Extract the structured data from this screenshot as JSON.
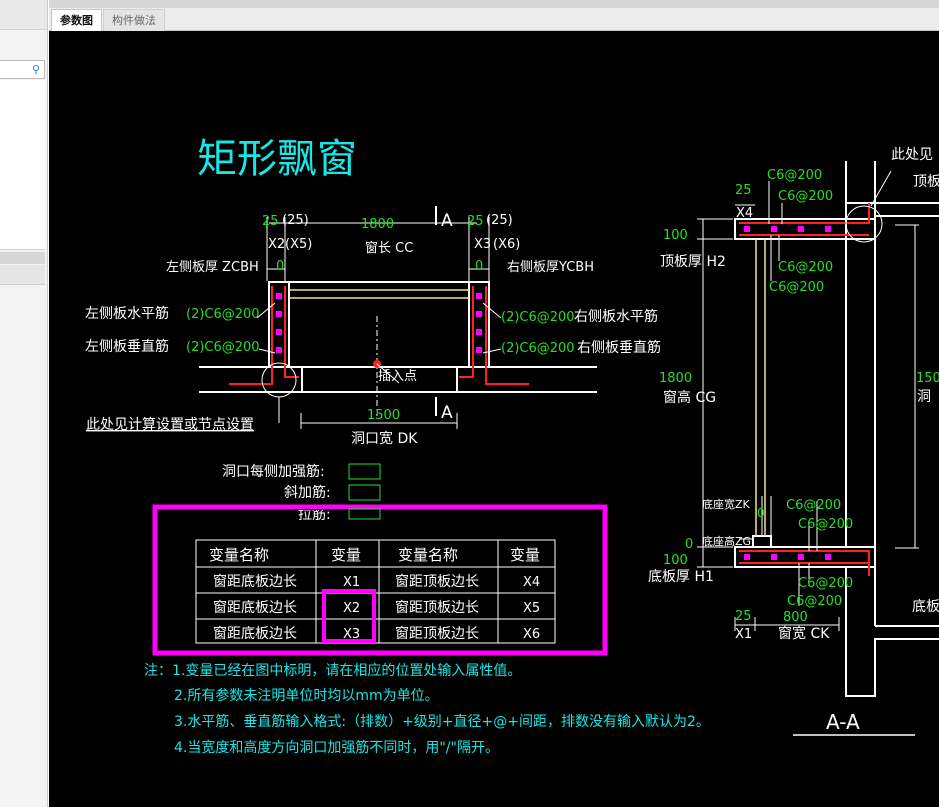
{
  "tabs": [
    {
      "label": "参数图"
    },
    {
      "label": "构件做法"
    }
  ],
  "drawing": {
    "title": "矩形飘窗",
    "plan": {
      "x2_val": "25",
      "x2_paren": "(25)",
      "x2_label": "X2",
      "x5_label": "(X5)",
      "cc_val": "1800",
      "cc_label": "窗长 CC",
      "x3_val": "25",
      "x3_paren": "(25)",
      "x3_label": "X3",
      "x6_label": "(X6)",
      "section_mark": "A",
      "left_thk_label": "左侧板厚 ZCBH",
      "left_thk_val": "0",
      "right_thk_label": "右侧板厚YCBH",
      "right_thk_val": "0",
      "left_h_label": "左侧板水平筋",
      "left_h_val": "(2)C6@200",
      "left_v_label": "左侧板垂直筋",
      "left_v_val": "(2)C6@200",
      "right_h_val": "(2)C6@200",
      "right_h_label": "右侧板水平筋",
      "right_v_val": "(2)C6@200",
      "right_v_label": "右侧板垂直筋",
      "insert_point": "插入点",
      "dk_val": "1500",
      "dk_label": "洞口宽 DK",
      "node_note": "此处见计算设置或节点设置"
    },
    "params": {
      "per_side_label": "洞口每侧加强筋:",
      "diag_label": "斜加筋:",
      "tie_label": "拉筋:"
    },
    "table": {
      "headers": [
        "变量名称",
        "变量",
        "变量名称",
        "变量"
      ],
      "rows": [
        [
          "窗距底板边长",
          "X1",
          "窗距顶板边长",
          "X4"
        ],
        [
          "窗距底板边长",
          "X2",
          "窗距顶板边长",
          "X5"
        ],
        [
          "窗距底板边长",
          "X3",
          "窗距顶板边长",
          "X6"
        ]
      ]
    },
    "notes": [
      "注：1.变量已经在图中标明，请在相应的位置处输入属性值。",
      "2.所有参数未注明单位时均以mm为单位。",
      "3.水平筋、垂直筋输入格式:（排数）+级别+直径+@+间距，排数没有输入默认为2。",
      "4.当宽度和高度方向洞口加强筋不同时，用\"/\"隔开。"
    ],
    "section": {
      "top_note": "此处见",
      "top_right": "顶板",
      "x4_val": "25",
      "x4_label": "X4",
      "c1": "C6@200",
      "c2": "C6@200",
      "c3": "C6@200",
      "c4": "C6@200",
      "h2_val": "100",
      "h2_label": "顶板厚 H2",
      "cg_val": "1800",
      "cg_label": "窗高 CG",
      "right_val": "150",
      "right_label": "洞",
      "zk_label": "底座宽ZK",
      "zk_val": "0",
      "zg_label": "底座高ZG",
      "zg_val": "0",
      "c5": "C6@200",
      "c6": "C6@200",
      "c7": "C6@200",
      "c8": "C6@200",
      "h1_val": "100",
      "h1_label": "底板厚 H1",
      "x1_val": "25",
      "x1_label": "X1",
      "ck_val": "800",
      "ck_label": "窗宽 CK",
      "bottom_right": "底板",
      "section_title": "A-A"
    }
  },
  "colors": {
    "canvas_bg": "#000000",
    "cyan": "#19e6e6",
    "green": "#22e022",
    "white": "#ffffff",
    "magenta": "#ff00ff",
    "red": "#ff2020",
    "yellow": "#f0e68c"
  }
}
